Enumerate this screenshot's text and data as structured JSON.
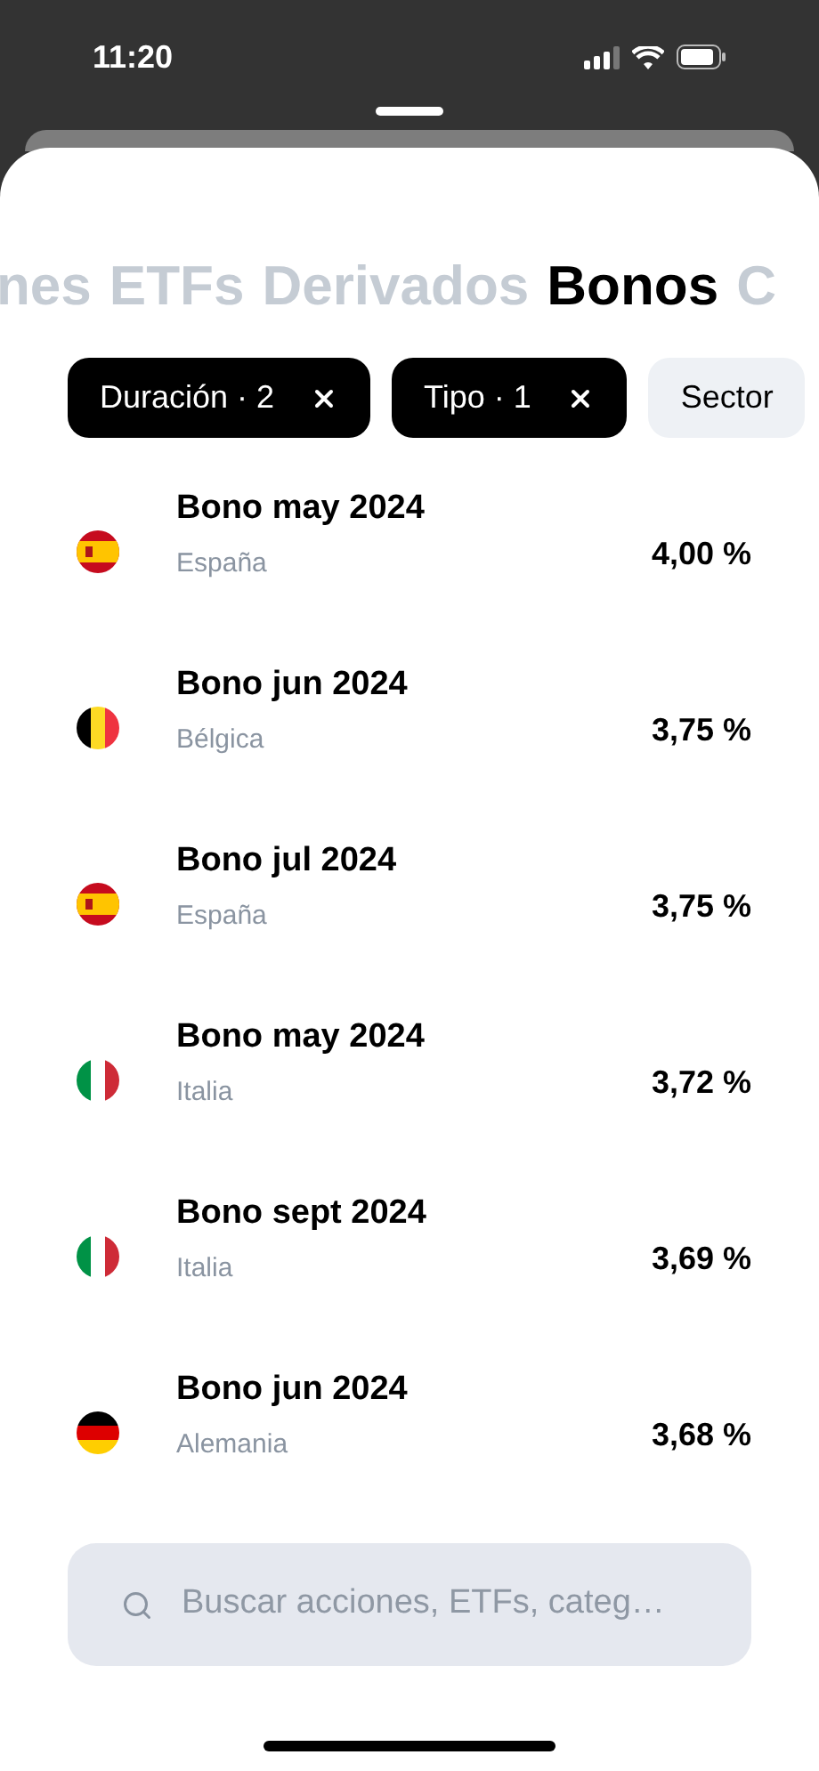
{
  "status_bar": {
    "time": "11:20"
  },
  "tabs": [
    {
      "label": "nes",
      "selected": false
    },
    {
      "label": "ETFs",
      "selected": false
    },
    {
      "label": "Derivados",
      "selected": false
    },
    {
      "label": "Bonos",
      "selected": true
    },
    {
      "label": "C",
      "selected": false
    }
  ],
  "filters": [
    {
      "label": "Duración · 2",
      "active": true
    },
    {
      "label": "Tipo · 1",
      "active": true
    },
    {
      "label": "Sector",
      "active": false
    }
  ],
  "bonds": [
    {
      "kind": "es",
      "name": "Bono may 2024",
      "country": "España",
      "yield": "4,00 %"
    },
    {
      "kind": "be",
      "name": "Bono jun 2024",
      "country": "Bélgica",
      "yield": "3,75 %"
    },
    {
      "kind": "es",
      "name": "Bono jul 2024",
      "country": "España",
      "yield": "3,75 %"
    },
    {
      "kind": "it",
      "name": "Bono may 2024",
      "country": "Italia",
      "yield": "3,72 %"
    },
    {
      "kind": "it",
      "name": "Bono sept 2024",
      "country": "Italia",
      "yield": "3,69 %"
    },
    {
      "kind": "de",
      "name": "Bono jun 2024",
      "country": "Alemania",
      "yield": "3,68 %"
    }
  ],
  "search": {
    "placeholder": "Buscar acciones, ETFs, categ…"
  }
}
